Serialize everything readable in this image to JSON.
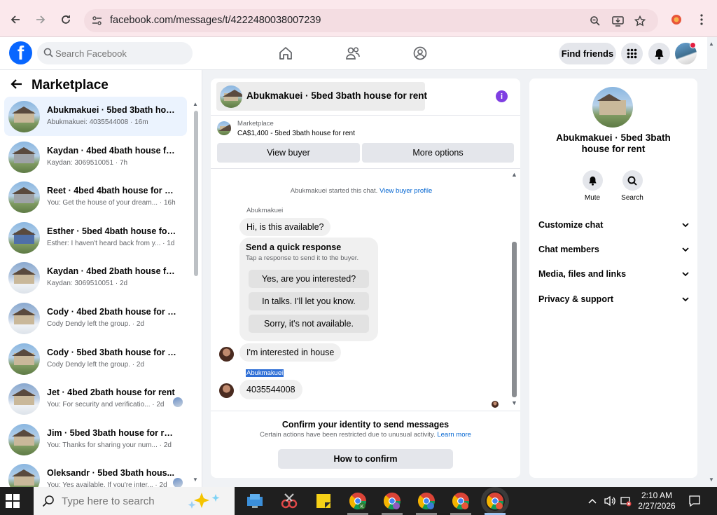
{
  "browser": {
    "url": "facebook.com/messages/t/4222480038007239"
  },
  "fb_header": {
    "search_placeholder": "Search Facebook",
    "find_friends_label": "Find friends"
  },
  "sidebar": {
    "title": "Marketplace",
    "conversations": [
      {
        "name": "Abukmakuei · 5bed 3bath hous...",
        "preview": "Abukmakuei: 4035544008 · 16m",
        "thumb": "house",
        "active": true
      },
      {
        "name": "Kaydan · 4bed 4bath house for ...",
        "preview": "Kaydan: 3069510051 · 7h",
        "thumb": "gray"
      },
      {
        "name": "Reet · 4bed 4bath house for rent",
        "preview": "You: Get the house of your dream... · 16h",
        "thumb": "gray"
      },
      {
        "name": "Esther · 5bed 4bath house for r...",
        "preview": "Esther: I haven't heard back from y... · 1d",
        "thumb": "blue"
      },
      {
        "name": "Kaydan · 4bed 2bath house for ...",
        "preview": "Kaydan: 3069510051 · 2d",
        "thumb": "snow"
      },
      {
        "name": "Cody · 4bed 2bath house for rent",
        "preview": "Cody Dendy left the group. · 2d",
        "thumb": "snow"
      },
      {
        "name": "Cody · 5bed 3bath house for rent",
        "preview": "Cody Dendy left the group. · 2d",
        "thumb": "house"
      },
      {
        "name": "Jet · 4bed 2bath house for rent",
        "preview": "You: For security and verificatio... · 2d",
        "thumb": "snow"
      },
      {
        "name": "Jim · 5bed 3bath house for rent",
        "preview": "You: Thanks for sharing your num... · 2d",
        "thumb": "house"
      },
      {
        "name": "Oleksandr · 5bed 3bath hous...",
        "preview": "You: Yes available. If you're inter... · 2d",
        "thumb": "house"
      }
    ]
  },
  "chat": {
    "title": "Abukmakuei · 5bed 3bath house for rent",
    "marketplace_label": "Marketplace",
    "listing": "CA$1,400 - 5bed 3bath house for rent",
    "view_buyer_label": "View buyer",
    "more_options_label": "More options",
    "started_text": "Abukmakuei started this chat.",
    "view_buyer_profile_link": "View buyer profile",
    "sender_label": "Abukmakuei",
    "message_1": "Hi, is this available?",
    "quick_response_title": "Send a quick response",
    "quick_response_sub": "Tap a response to send it to the buyer.",
    "quick_replies": [
      "Yes, are you interested?",
      "In talks. I'll let you know.",
      "Sorry, it's not available."
    ],
    "message_2": "I'm interested in house",
    "selected_sender": "Abukmakuei",
    "message_3": "4035544008",
    "confirm_title": "Confirm your identity to send messages",
    "confirm_sub": "Certain actions have been restricted due to unusual activity.",
    "learn_more_link": "Learn more",
    "how_to_confirm_label": "How to confirm"
  },
  "details": {
    "title": "Abukmakuei · 5bed 3bath house for rent",
    "mute_label": "Mute",
    "search_label": "Search",
    "sections": [
      "Customize chat",
      "Chat members",
      "Media, files and links",
      "Privacy & support"
    ]
  },
  "taskbar": {
    "search_placeholder": "Type here to search",
    "time": "2:10 AM",
    "date": "2/27/2026"
  },
  "colors": {
    "fb_blue": "#0866ff",
    "link_blue": "#0064d1",
    "info_purple": "#7f3fe2",
    "selection_blue": "#2f6fd6"
  }
}
